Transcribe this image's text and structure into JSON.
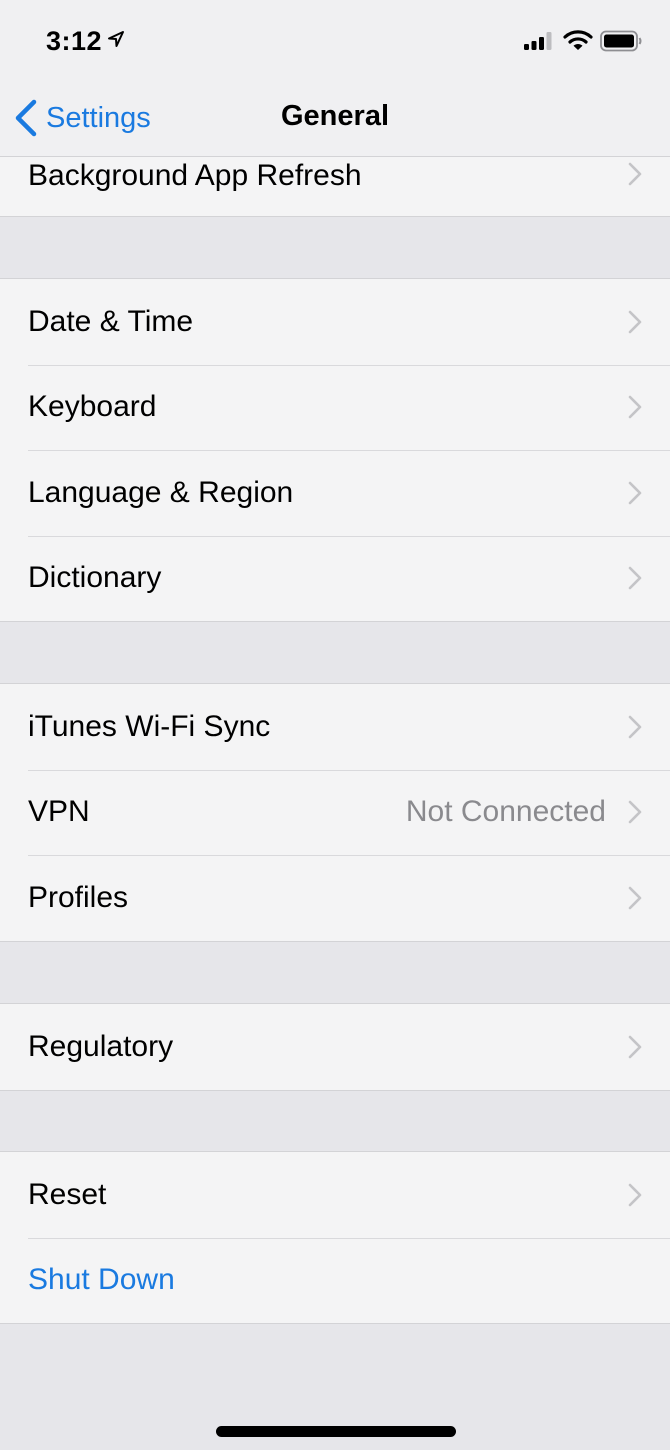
{
  "status_bar": {
    "time": "3:12",
    "location_icon": "location-arrow-icon",
    "signal_icon": "cellular-signal-icon",
    "wifi_icon": "wifi-icon",
    "battery_icon": "battery-icon"
  },
  "nav": {
    "back_label": "Settings",
    "title": "General"
  },
  "colors": {
    "accent": "#1a7ae0",
    "background": "#e6e6ea",
    "cell": "#f4f4f5",
    "secondary_text": "#8a8a8e"
  },
  "groups": [
    {
      "rows": [
        {
          "label": "Background App Refresh",
          "chevron": true
        }
      ]
    },
    {
      "rows": [
        {
          "label": "Date & Time",
          "chevron": true
        },
        {
          "label": "Keyboard",
          "chevron": true
        },
        {
          "label": "Language & Region",
          "chevron": true
        },
        {
          "label": "Dictionary",
          "chevron": true
        }
      ]
    },
    {
      "rows": [
        {
          "label": "iTunes Wi-Fi Sync",
          "chevron": true
        },
        {
          "label": "VPN",
          "value": "Not Connected",
          "chevron": true
        },
        {
          "label": "Profiles",
          "chevron": true
        }
      ]
    },
    {
      "rows": [
        {
          "label": "Regulatory",
          "chevron": true
        }
      ]
    },
    {
      "rows": [
        {
          "label": "Reset",
          "chevron": true
        },
        {
          "label": "Shut Down",
          "chevron": false
        }
      ]
    }
  ]
}
